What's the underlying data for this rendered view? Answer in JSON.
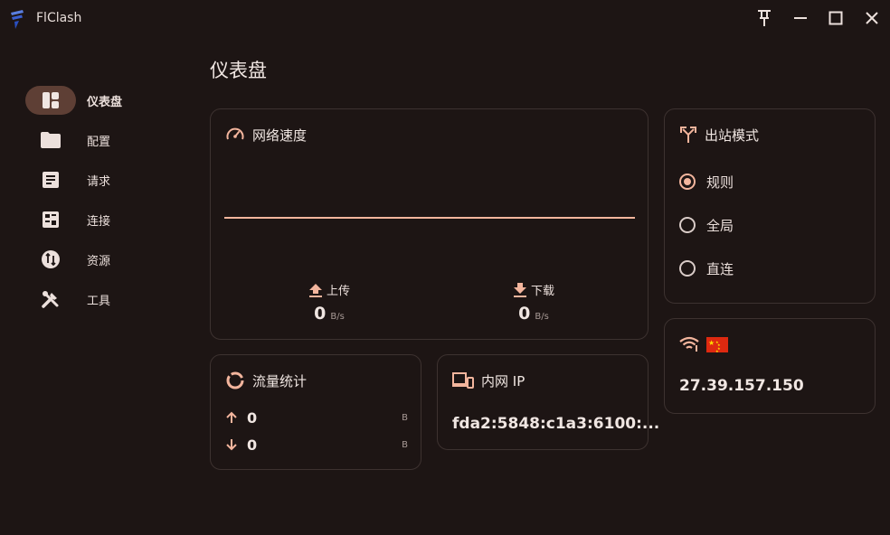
{
  "app": {
    "title": "FlClash"
  },
  "sidebar": {
    "items": [
      {
        "label": "仪表盘",
        "icon": "dashboard-icon",
        "active": true
      },
      {
        "label": "配置",
        "icon": "folder-icon"
      },
      {
        "label": "请求",
        "icon": "request-icon"
      },
      {
        "label": "连接",
        "icon": "connection-icon"
      },
      {
        "label": "资源",
        "icon": "resource-icon"
      },
      {
        "label": "工具",
        "icon": "tools-icon"
      }
    ]
  },
  "page": {
    "title": "仪表盘"
  },
  "network_speed": {
    "title": "网络速度",
    "upload": {
      "label": "上传",
      "value": "0",
      "unit": "B/s"
    },
    "download": {
      "label": "下载",
      "value": "0",
      "unit": "B/s"
    }
  },
  "outbound_mode": {
    "title": "出站模式",
    "options": [
      {
        "label": "规则",
        "selected": true
      },
      {
        "label": "全局",
        "selected": false
      },
      {
        "label": "直连",
        "selected": false
      }
    ]
  },
  "network_detection": {
    "ip": "27.39.157.150",
    "flag": "CN"
  },
  "traffic_stats": {
    "title": "流量统计",
    "up": {
      "value": "0",
      "unit": "B"
    },
    "down": {
      "value": "0",
      "unit": "B"
    }
  },
  "intranet_ip": {
    "title": "内网 IP",
    "value": "fda2:5848:c1a3:6100:..."
  },
  "colors": {
    "accent": "#f3b59d",
    "background": "#1d1514",
    "active_pill": "#5e3f35",
    "border": "#3d3230"
  }
}
